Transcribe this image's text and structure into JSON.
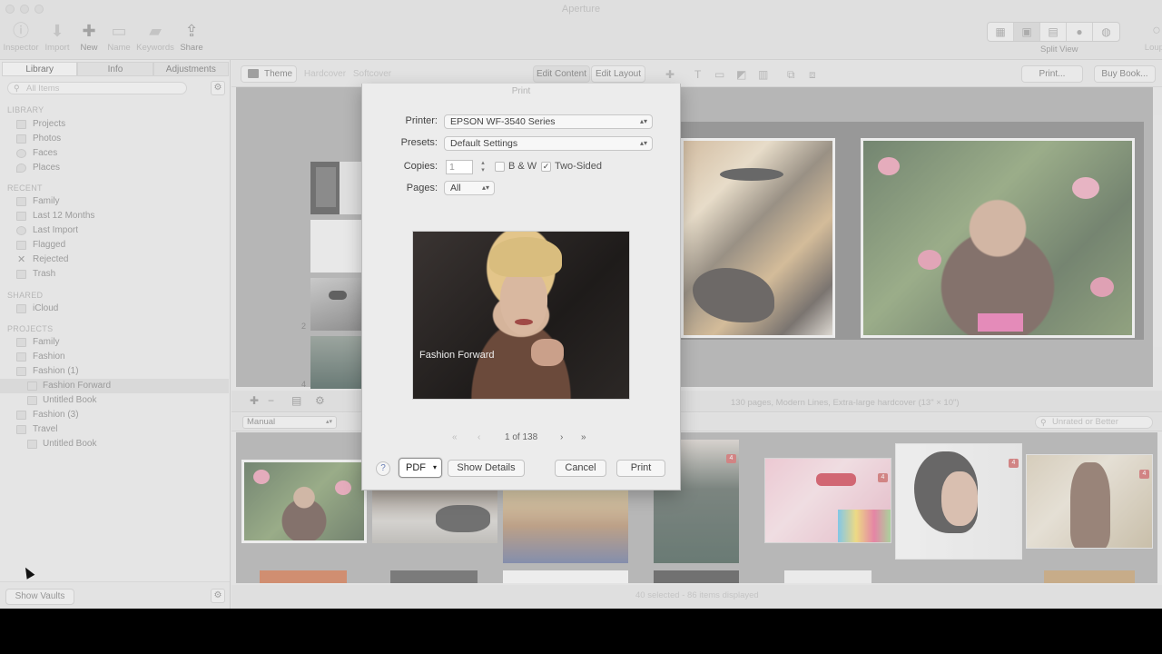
{
  "window": {
    "title": "Aperture"
  },
  "toolbar": {
    "inspector": "Inspector",
    "import": "Import",
    "new": "New",
    "name": "Name",
    "keywords": "Keywords",
    "share": "Share",
    "split_view": "Split View",
    "loupe": "Loupe"
  },
  "sidebar": {
    "tabs": [
      "Library",
      "Info",
      "Adjustments"
    ],
    "search_placeholder": "All Items",
    "sections": {
      "library": "LIBRARY",
      "recent": "RECENT",
      "shared": "SHARED",
      "projects": "PROJECTS"
    },
    "library_items": [
      "Projects",
      "Photos",
      "Faces",
      "Places"
    ],
    "recent_items": [
      "Family",
      "Last 12 Months",
      "Last Import",
      "Flagged",
      "Rejected",
      "Trash"
    ],
    "shared_items": [
      "iCloud"
    ],
    "project_items": [
      "Family",
      "Fashion",
      "Fashion (1)",
      "Fashion Forward",
      "Untitled Book",
      "Fashion (3)",
      "Travel",
      "Untitled Book"
    ],
    "show_vaults": "Show Vaults"
  },
  "main_toolbar": {
    "theme": "Theme",
    "hardcover": "Hardcover",
    "softcover": "Softcover",
    "edit_content": "Edit Content",
    "edit_layout": "Edit Layout",
    "print": "Print...",
    "buy_book": "Buy Book..."
  },
  "book": {
    "info": "130 pages, Modern Lines, Extra-large hardcover (13\" × 10\")",
    "page_labels": [
      "2",
      "4"
    ],
    "sort": "Manual",
    "rating_filter": "Unrated or Better",
    "footer": "40 selected - 86 items displayed"
  },
  "print_dialog": {
    "title": "Print",
    "printer_label": "Printer:",
    "printer_value": "EPSON WF-3540 Series",
    "presets_label": "Presets:",
    "presets_value": "Default Settings",
    "copies_label": "Copies:",
    "copies_value": "1",
    "bw_label": "B & W",
    "two_sided_label": "Two-Sided",
    "two_sided_checked": "✓",
    "pages_label": "Pages:",
    "pages_value": "All",
    "preview_caption": "Fashion Forward",
    "page_indicator": "1 of 138",
    "pdf": "PDF",
    "show_details": "Show Details",
    "cancel": "Cancel",
    "print": "Print"
  },
  "badges": [
    "4",
    "4",
    "4",
    "4"
  ],
  "colors": {
    "accent_badge": "#c64a4a",
    "help_icon": "#6a7fb5"
  }
}
